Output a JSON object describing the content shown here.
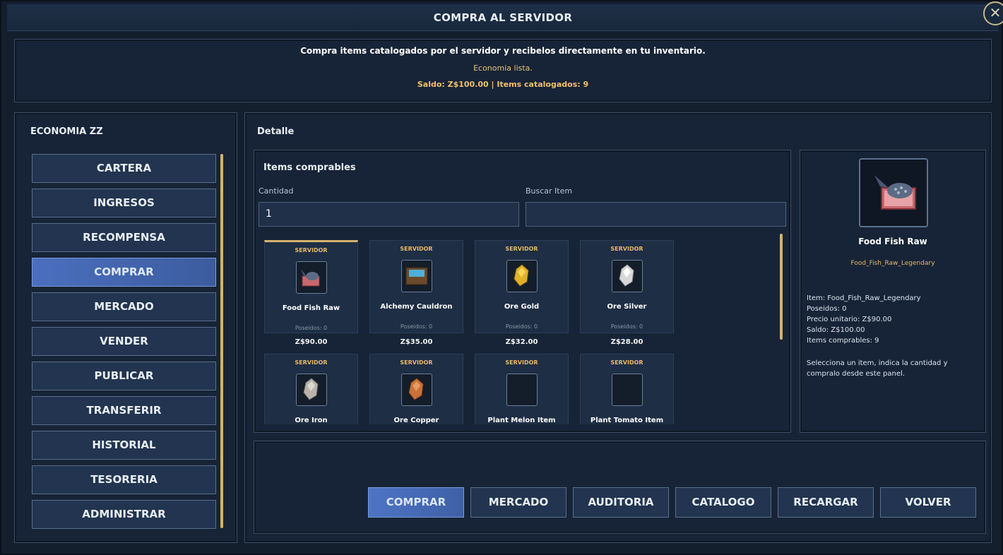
{
  "window": {
    "title": "COMPRA AL SERVIDOR",
    "close_symbol": "✕"
  },
  "info": {
    "description": "Compra items catalogados por el servidor y recibelos directamente en tu inventario.",
    "status": "Economia lista.",
    "saldo_line": "Saldo: Z$100.00 | Items catalogados: 9"
  },
  "sidebar": {
    "title": "ECONOMIA ZZ",
    "items": [
      {
        "label": "CARTERA",
        "active": false
      },
      {
        "label": "INGRESOS",
        "active": false
      },
      {
        "label": "RECOMPENSA",
        "active": false
      },
      {
        "label": "COMPRAR",
        "active": true
      },
      {
        "label": "MERCADO",
        "active": false
      },
      {
        "label": "VENDER",
        "active": false
      },
      {
        "label": "PUBLICAR",
        "active": false
      },
      {
        "label": "TRANSFERIR",
        "active": false
      },
      {
        "label": "HISTORIAL",
        "active": false
      },
      {
        "label": "TESORERIA",
        "active": false
      },
      {
        "label": "ADMINISTRAR",
        "active": false
      }
    ]
  },
  "detail": {
    "title": "Detalle",
    "items_title": "Items comprables",
    "quantity_label": "Cantidad",
    "quantity_value": "1",
    "search_label": "Buscar Item",
    "search_value": ""
  },
  "items": [
    {
      "tag": "SERVIDOR",
      "name": "Food Fish Raw",
      "owned": "Poseidos: 0",
      "price": "Z$90.00",
      "icon": "fish-icon",
      "selected": true
    },
    {
      "tag": "SERVIDOR",
      "name": "Alchemy Cauldron",
      "owned": "Poseidos: 0",
      "price": "Z$35.00",
      "icon": "cauldron-icon",
      "selected": false
    },
    {
      "tag": "SERVIDOR",
      "name": "Ore Gold",
      "owned": "Poseidos: 0",
      "price": "Z$32.00",
      "icon": "gold-ore-icon",
      "selected": false
    },
    {
      "tag": "SERVIDOR",
      "name": "Ore Silver",
      "owned": "Poseidos: 0",
      "price": "Z$28.00",
      "icon": "silver-ore-icon",
      "selected": false
    },
    {
      "tag": "SERVIDOR",
      "name": "Ore Iron",
      "icon": "iron-ore-icon",
      "selected": false
    },
    {
      "tag": "SERVIDOR",
      "name": "Ore Copper",
      "icon": "copper-ore-icon",
      "selected": false
    },
    {
      "tag": "SERVIDOR",
      "name": "Plant Melon Item",
      "icon": "empty-icon",
      "selected": false
    },
    {
      "tag": "SERVIDOR",
      "name": "Plant Tomato Item",
      "icon": "empty-icon",
      "selected": false
    }
  ],
  "preview": {
    "name": "Food Fish Raw",
    "id": "Food_Fish_Raw_Legendary",
    "lines": [
      "Item: Food_Fish_Raw_Legendary",
      "Poseidos: 0",
      "Precio unitario: Z$90.00",
      "Saldo: Z$100.00",
      "Items comprables: 9"
    ],
    "hint": "Selecciona un item, indica la cantidad y compralo desde este panel.",
    "icon": "fish-icon"
  },
  "actions": [
    {
      "label": "COMPRAR",
      "primary": true
    },
    {
      "label": "MERCADO",
      "primary": false
    },
    {
      "label": "AUDITORIA",
      "primary": false
    },
    {
      "label": "CATALOGO",
      "primary": false
    },
    {
      "label": "RECARGAR",
      "primary": false
    },
    {
      "label": "VOLVER",
      "primary": false
    }
  ],
  "colors": {
    "accent": "#d6b26e",
    "active_button": "#4b6fbf",
    "panel": "#172437"
  }
}
